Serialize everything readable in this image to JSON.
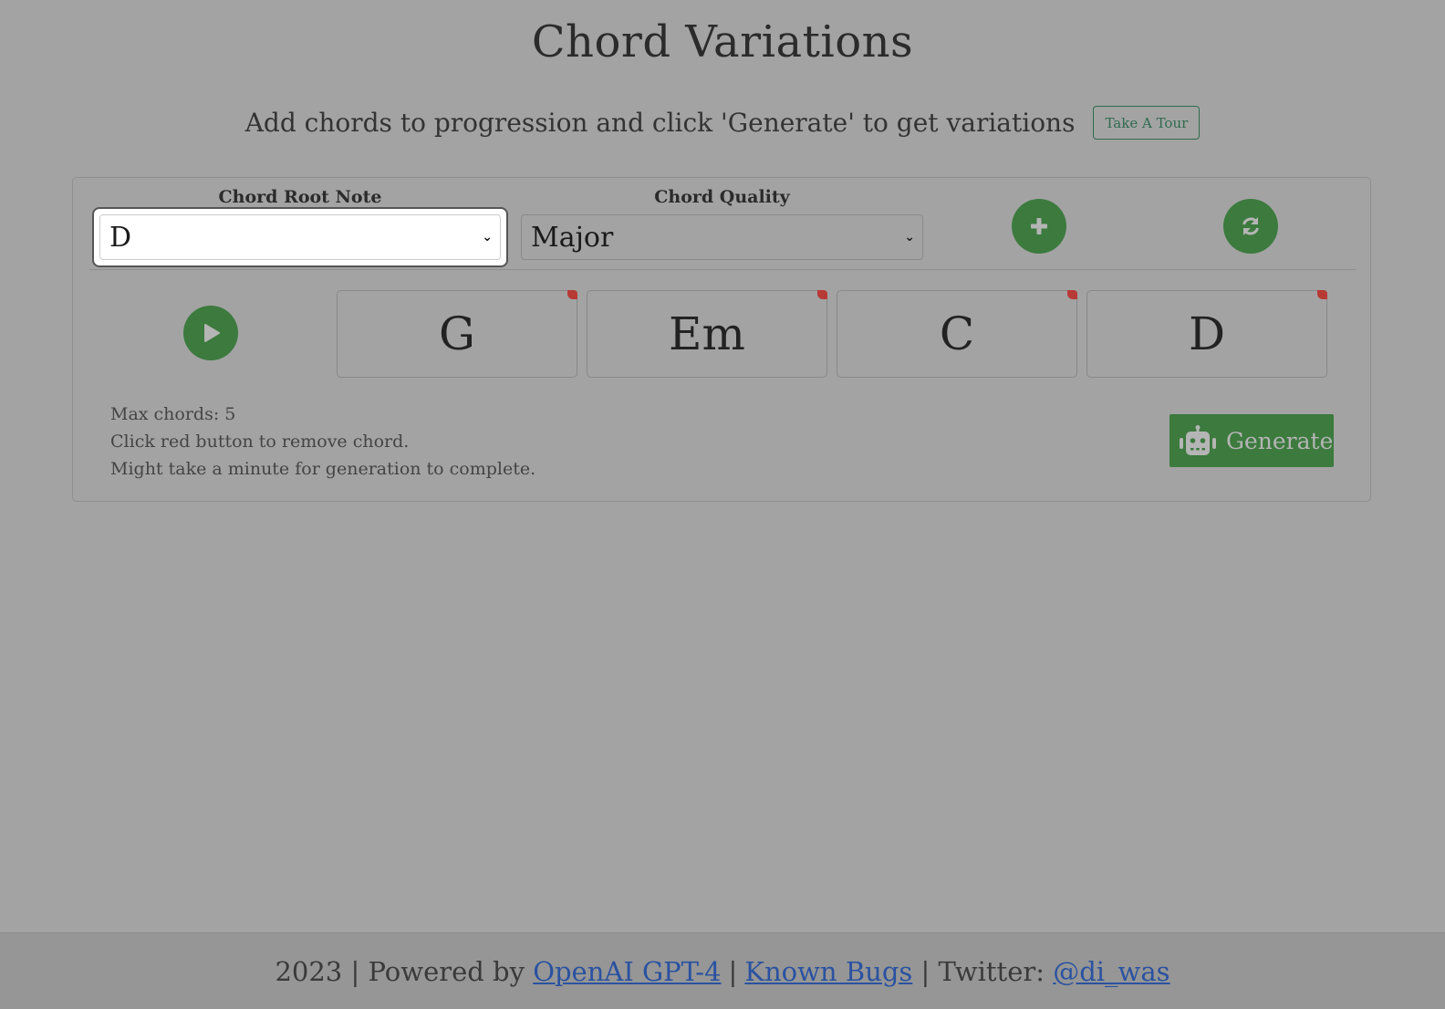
{
  "header": {
    "title": "Chord Variations",
    "subtitle": "Add chords to progression and click 'Generate' to get variations",
    "tour_button": "Take A Tour"
  },
  "controls": {
    "root_label": "Chord Root Note",
    "root_value": "D",
    "quality_label": "Chord Quality",
    "quality_value": "Major",
    "add_icon": "plus-icon",
    "reset_icon": "refresh-icon"
  },
  "progression": {
    "play_icon": "play-icon",
    "chords": [
      {
        "name": "G"
      },
      {
        "name": "Em"
      },
      {
        "name": "C"
      },
      {
        "name": "D"
      }
    ]
  },
  "notes": {
    "max": "Max chords: 5",
    "remove_hint": "Click red button to remove chord.",
    "wait_hint": "Might take a minute for generation to complete."
  },
  "generate": {
    "label": "Generate",
    "icon": "robot-icon"
  },
  "footer": {
    "prefix": "2023 | Powered by",
    "link1": "OpenAI GPT-4",
    "sep1": "|",
    "link2": "Known Bugs",
    "twitter_label": "| Twitter:",
    "twitter_handle": "@di_was"
  },
  "colors": {
    "accent": "#3c7a3e",
    "remove": "#b73a35",
    "link": "#2a52a0",
    "overlay_bg": "#a3a3a3"
  }
}
